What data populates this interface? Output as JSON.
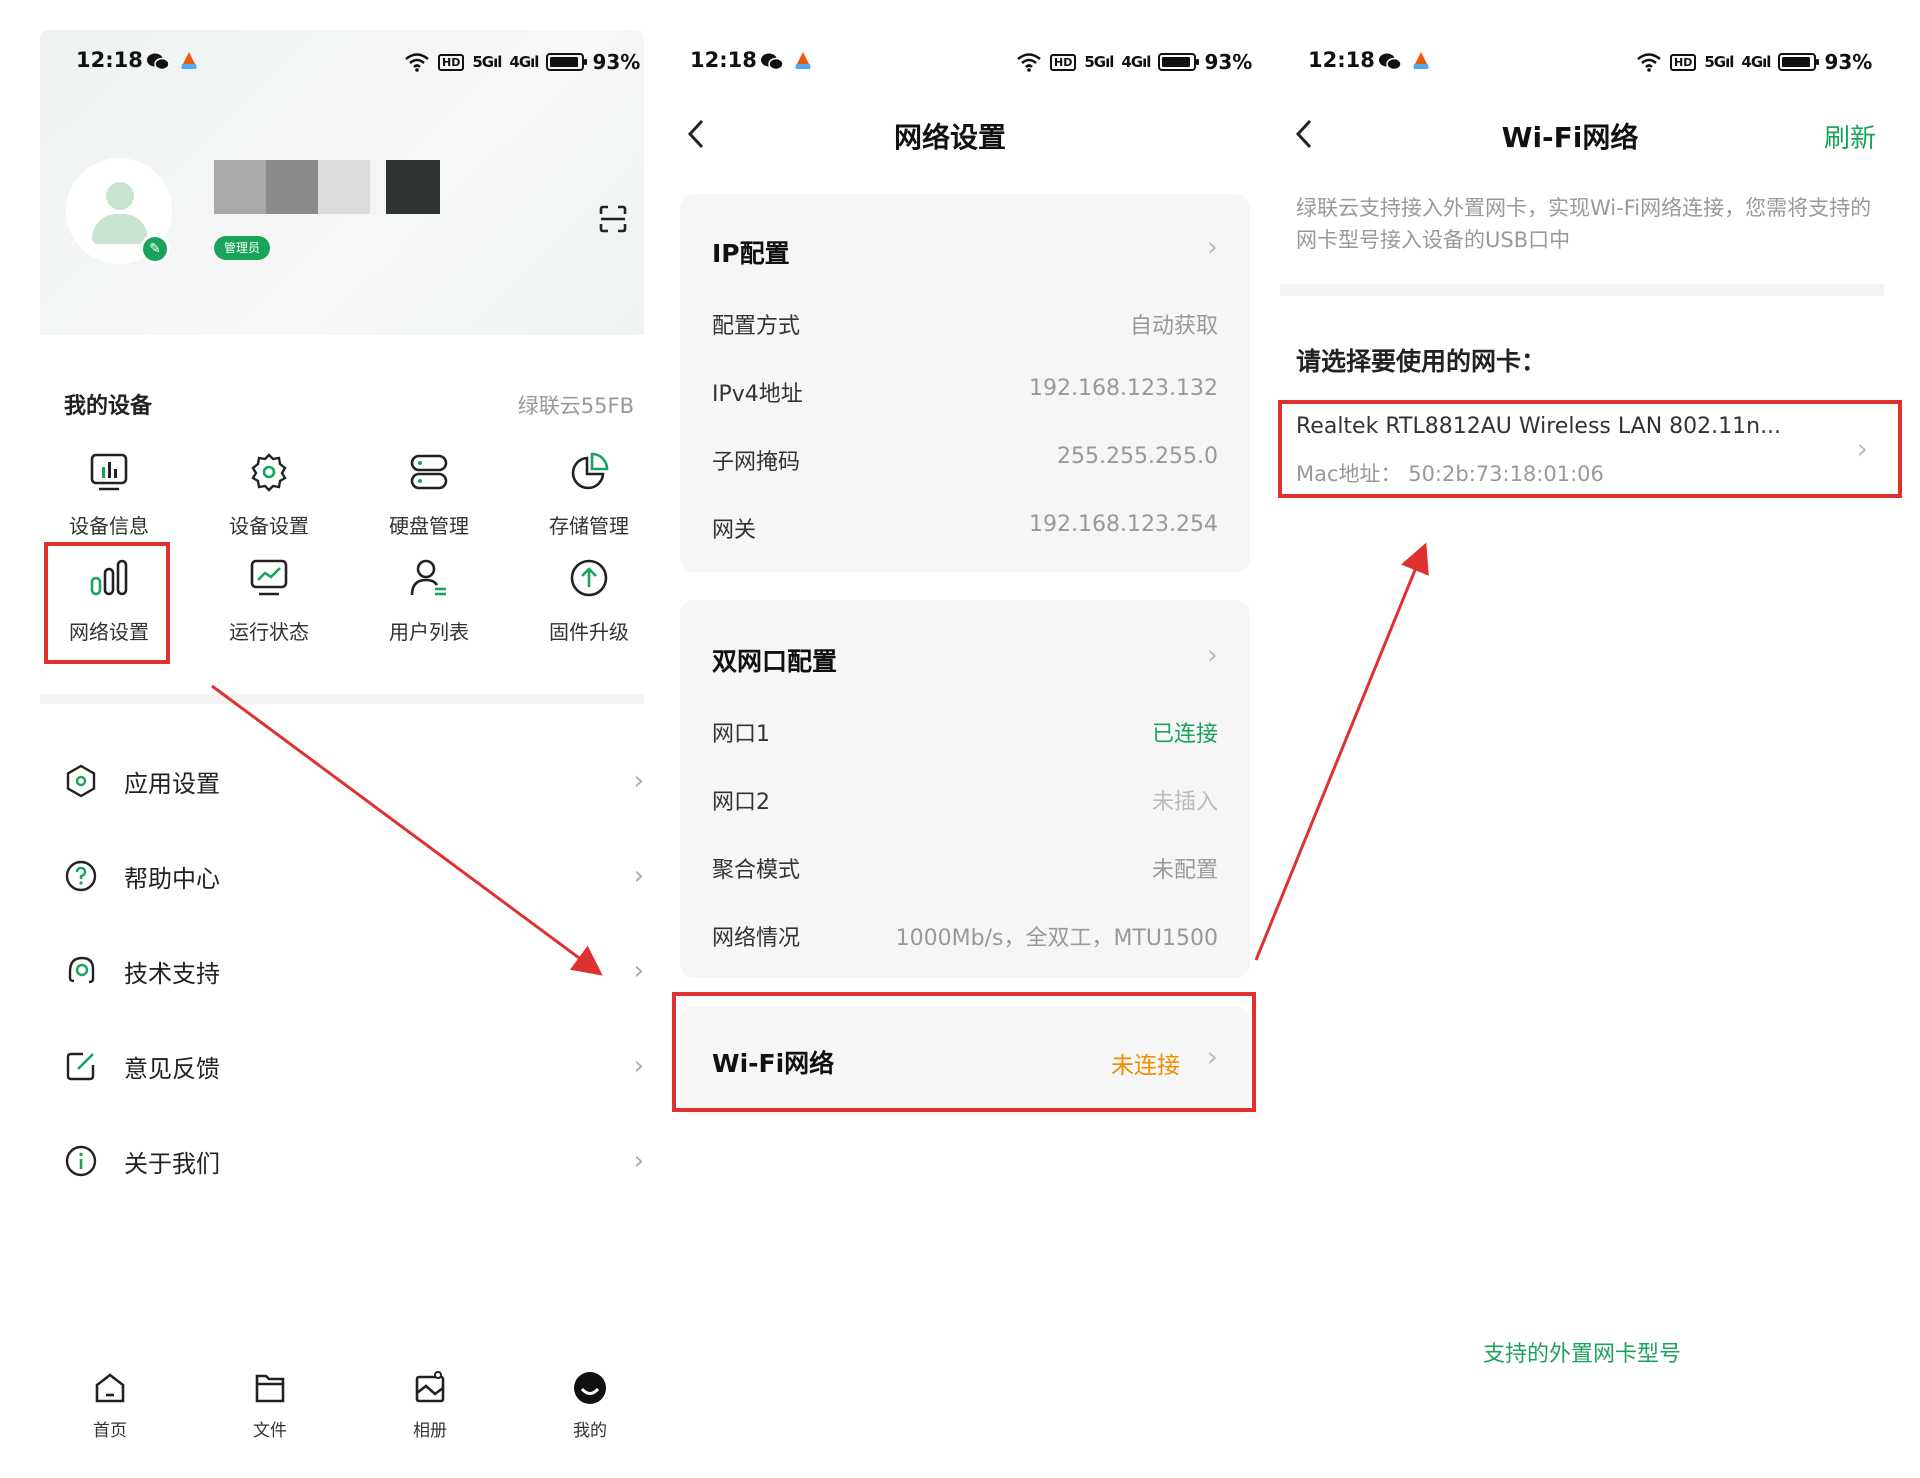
{
  "status_bar": {
    "time": "12:18",
    "battery": "93%",
    "hd_label": "HD",
    "signal1": "5G",
    "signal2": "4G"
  },
  "panel1": {
    "admin_badge": "管理员",
    "my_devices_title": "我的设备",
    "device_name": "绿联云55FB",
    "grid": [
      {
        "label": "设备信息",
        "icon": "device-info-icon"
      },
      {
        "label": "设备设置",
        "icon": "gear-icon"
      },
      {
        "label": "硬盘管理",
        "icon": "disk-icon"
      },
      {
        "label": "存储管理",
        "icon": "pie-chart-icon"
      },
      {
        "label": "网络设置",
        "icon": "network-bars-icon"
      },
      {
        "label": "运行状态",
        "icon": "monitor-chart-icon"
      },
      {
        "label": "用户列表",
        "icon": "user-list-icon"
      },
      {
        "label": "固件升级",
        "icon": "upgrade-icon"
      }
    ],
    "menu": [
      {
        "label": "应用设置",
        "icon": "hexagon-settings-icon"
      },
      {
        "label": "帮助中心",
        "icon": "help-circle-icon"
      },
      {
        "label": "技术支持",
        "icon": "support-icon"
      },
      {
        "label": "意见反馈",
        "icon": "feedback-edit-icon"
      },
      {
        "label": "关于我们",
        "icon": "info-circle-icon"
      }
    ],
    "tabs": [
      {
        "label": "首页",
        "icon": "home-icon"
      },
      {
        "label": "文件",
        "icon": "folder-icon"
      },
      {
        "label": "相册",
        "icon": "album-icon"
      },
      {
        "label": "我的",
        "icon": "profile-icon"
      }
    ]
  },
  "panel2": {
    "title": "网络设置",
    "ip_card": {
      "title": "IP配置",
      "rows": [
        {
          "label": "配置方式",
          "value": "自动获取"
        },
        {
          "label": "IPv4地址",
          "value": "192.168.123.132"
        },
        {
          "label": "子网掩码",
          "value": "255.255.255.0"
        },
        {
          "label": "网关",
          "value": "192.168.123.254"
        }
      ]
    },
    "dual_card": {
      "title": "双网口配置",
      "rows": [
        {
          "label": "网口1",
          "value": "已连接"
        },
        {
          "label": "网口2",
          "value": "未插入"
        },
        {
          "label": "聚合模式",
          "value": "未配置"
        },
        {
          "label": "网络情况",
          "value": "1000Mb/s，全双工，MTU1500"
        }
      ]
    },
    "wifi_row": {
      "label": "Wi-Fi网络",
      "value": "未连接"
    }
  },
  "panel3": {
    "title": "Wi-Fi网络",
    "refresh": "刷新",
    "intro": "绿联云支持接入外置网卡，实现Wi-Fi网络连接，您需将支持的网卡型号接入设备的USB口中",
    "select_title": "请选择要使用的网卡：",
    "nic_name": "Realtek RTL8812AU Wireless LAN 802.11n...",
    "nic_mac": "Mac地址：  50:2b:73:18:01:06",
    "support_link": "支持的外置网卡型号"
  },
  "colors": {
    "accent_green": "#1aa35a",
    "warning_orange": "#f08c00",
    "highlight_red": "#e03131"
  }
}
